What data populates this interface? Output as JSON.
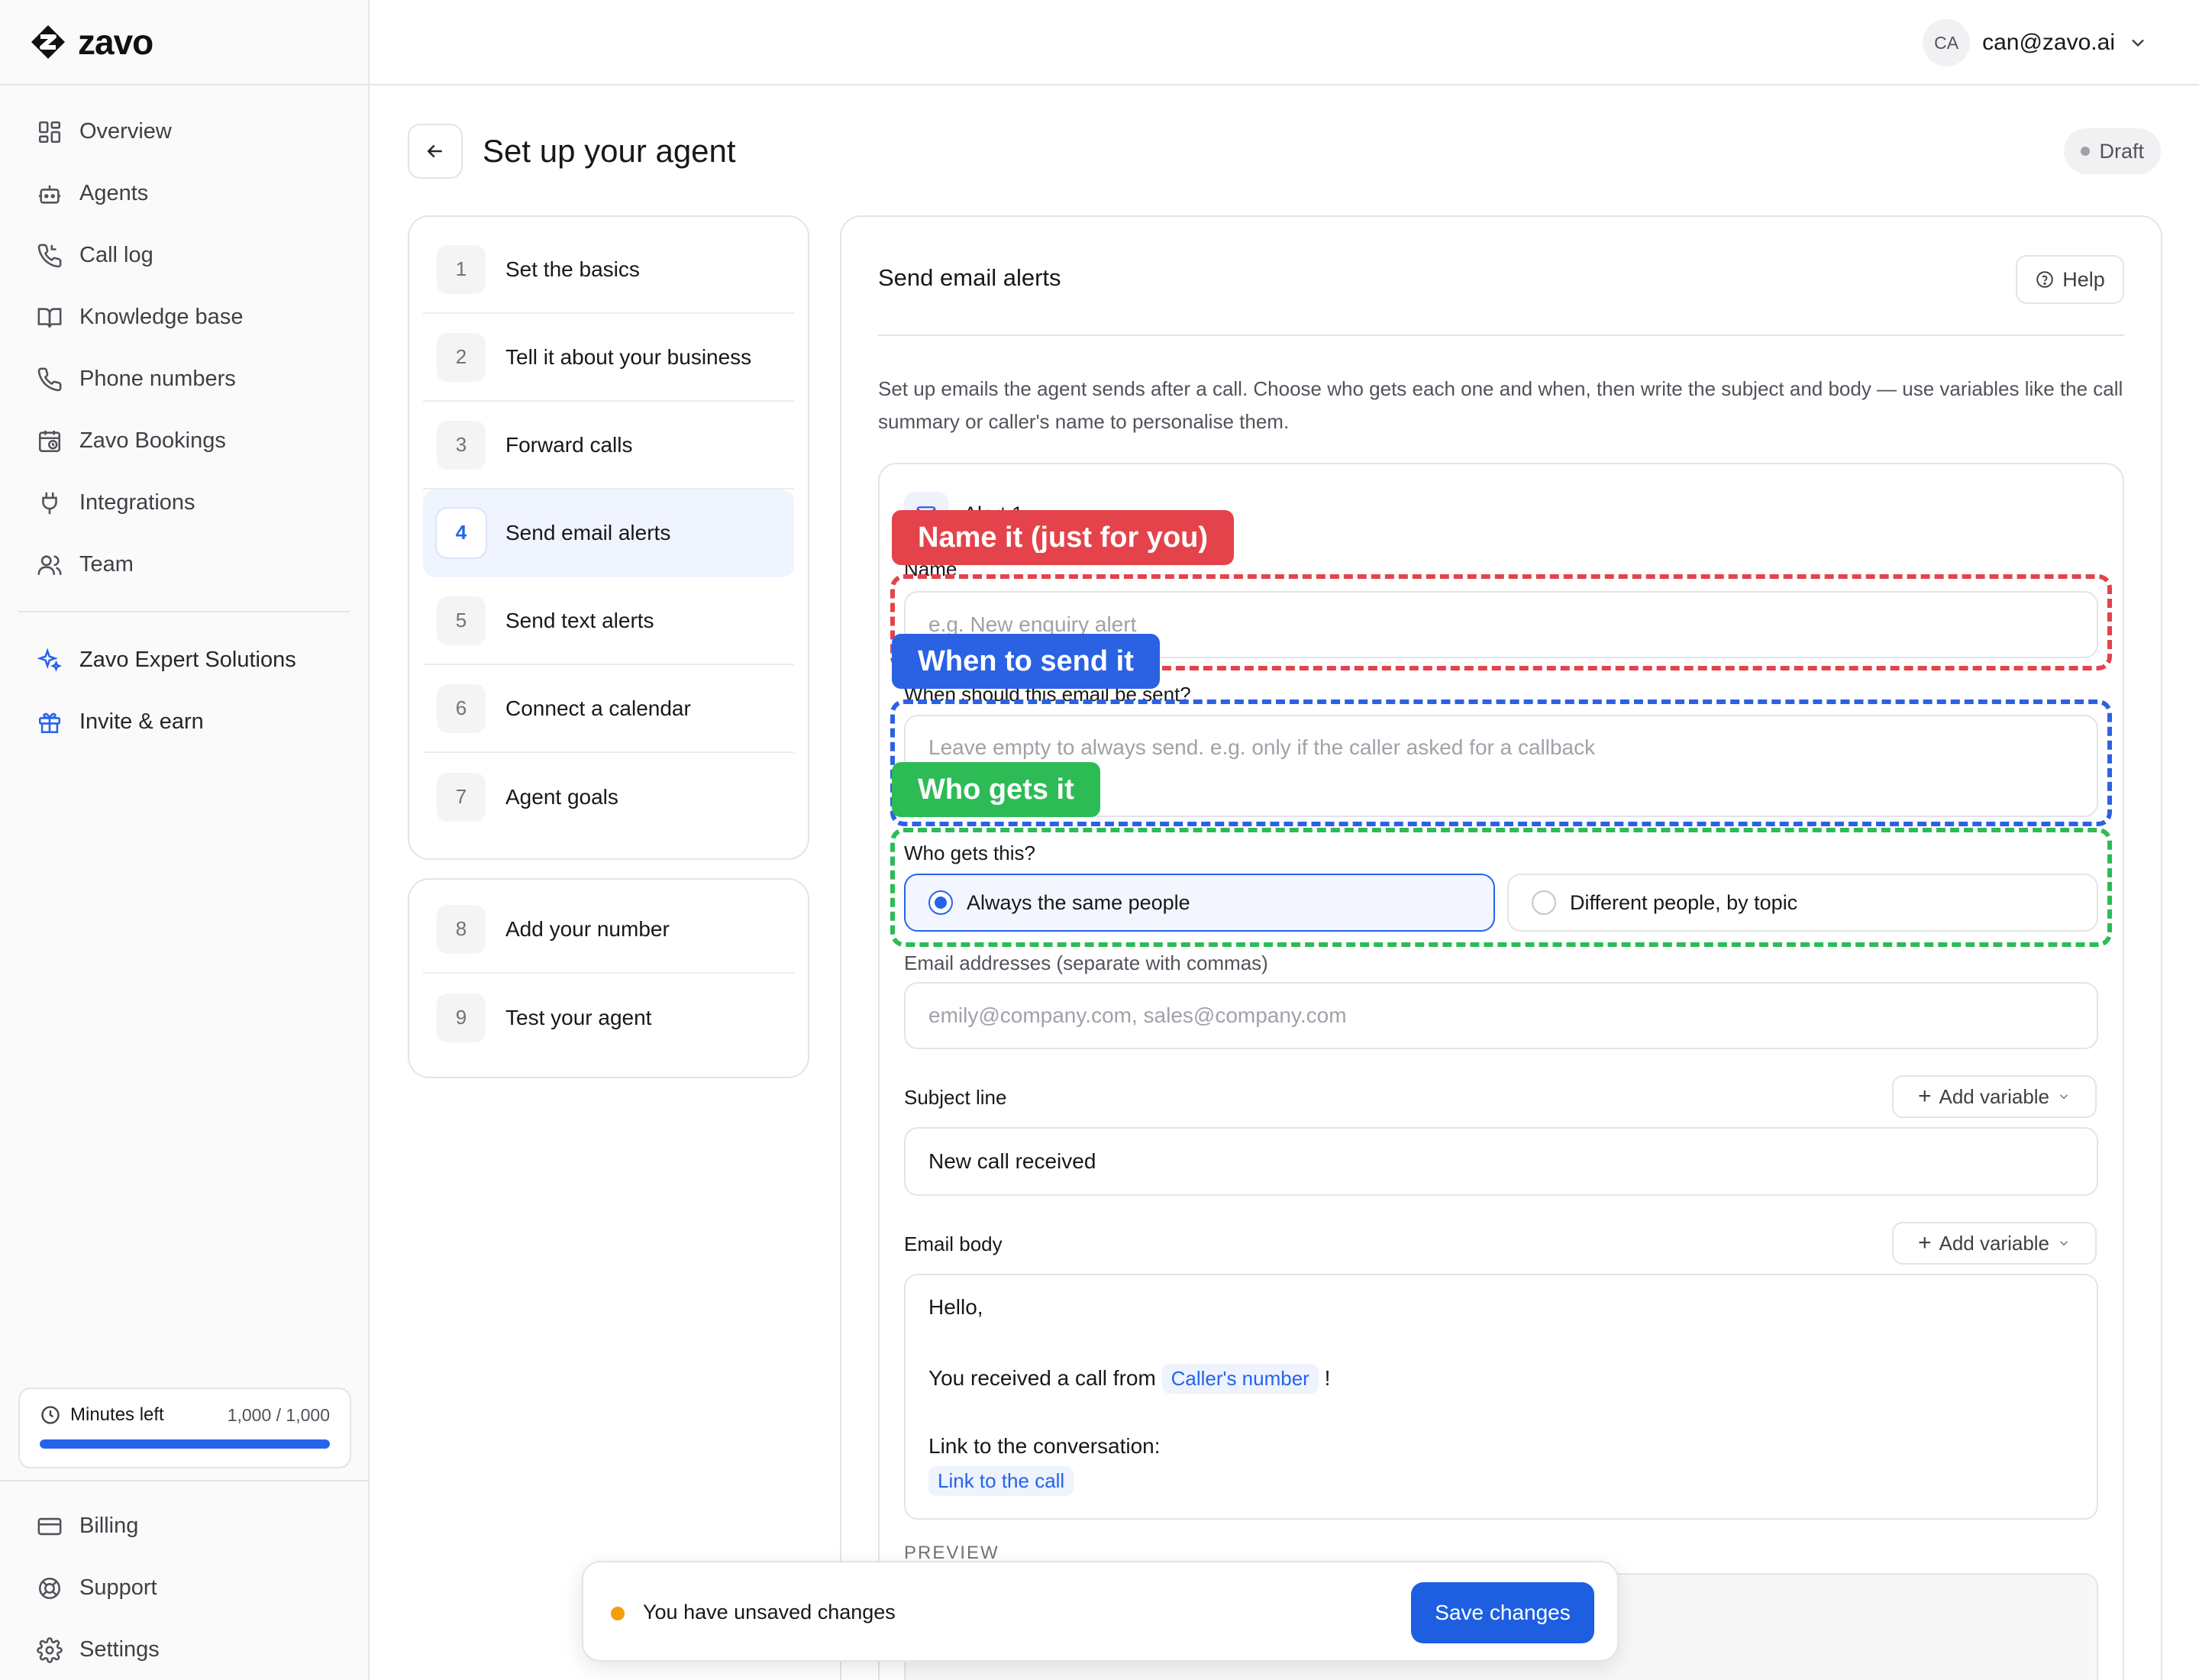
{
  "brand": {
    "name": "zavo"
  },
  "sidebar": {
    "items": [
      {
        "label": "Overview",
        "icon": "grid-icon"
      },
      {
        "label": "Agents",
        "icon": "robot-icon"
      },
      {
        "label": "Call log",
        "icon": "phone-log-icon"
      },
      {
        "label": "Knowledge base",
        "icon": "book-icon"
      },
      {
        "label": "Phone numbers",
        "icon": "phone-icon"
      },
      {
        "label": "Zavo Bookings",
        "icon": "calendar-clock-icon"
      },
      {
        "label": "Integrations",
        "icon": "plug-icon"
      },
      {
        "label": "Team",
        "icon": "users-icon"
      }
    ],
    "extras": [
      {
        "label": "Zavo Expert Solutions",
        "icon": "sparkles-icon"
      },
      {
        "label": "Invite & earn",
        "icon": "gift-icon"
      }
    ],
    "minutes": {
      "label": "Minutes left",
      "value": "1,000 / 1,000",
      "fraction": 1.0
    },
    "bottom": [
      {
        "label": "Billing",
        "icon": "card-icon"
      },
      {
        "label": "Support",
        "icon": "lifebuoy-icon"
      },
      {
        "label": "Settings",
        "icon": "gear-icon"
      }
    ]
  },
  "topbar": {
    "avatar_initials": "CA",
    "email": "can@zavo.ai"
  },
  "header": {
    "title": "Set up your agent",
    "status": "Draft"
  },
  "steps": {
    "group1": [
      {
        "num": "1",
        "label": "Set the basics"
      },
      {
        "num": "2",
        "label": "Tell it about your business"
      },
      {
        "num": "3",
        "label": "Forward calls"
      },
      {
        "num": "4",
        "label": "Send email alerts",
        "active": true
      },
      {
        "num": "5",
        "label": "Send text alerts"
      },
      {
        "num": "6",
        "label": "Connect a calendar"
      },
      {
        "num": "7",
        "label": "Agent goals"
      }
    ],
    "group2": [
      {
        "num": "8",
        "label": "Add your number"
      },
      {
        "num": "9",
        "label": "Test your agent"
      }
    ]
  },
  "section": {
    "title": "Send email alerts",
    "help_label": "Help",
    "description": "Set up emails the agent sends after a call. Choose who gets each one and when, then write the subject and body — use variables like the call summary or caller's name to personalise them."
  },
  "alert": {
    "title": "Alert 1",
    "name_label": "Name",
    "name_placeholder": "e.g. New enquiry alert",
    "when_label": "When should this email be sent?",
    "when_placeholder": "Leave empty to always send. e.g. only if the caller asked for a callback",
    "who_label": "Who gets this?",
    "who_options": [
      "Always the same people",
      "Different people, by topic"
    ],
    "who_selected": "Always the same people",
    "emails_label": "Email addresses (separate with commas)",
    "emails_placeholder": "emily@company.com, sales@company.com",
    "subject_label": "Subject line",
    "subject_value": "New call received",
    "add_variable_label": "Add variable",
    "body_label": "Email body",
    "body": {
      "line1": "Hello,",
      "line2_text": "You received a call from",
      "line2_chip": "Caller's number",
      "line2_end": "!",
      "line3": "Link to the conversation:",
      "line4_chip": "Link to the call"
    },
    "preview_label": "PREVIEW"
  },
  "annotations": {
    "red": "Name it (just for you)",
    "blue": "When to send it",
    "green": "Who gets it"
  },
  "toast": {
    "message": "You have unsaved changes",
    "save_label": "Save changes"
  },
  "colors": {
    "accent": "#2563eb",
    "red": "#e4434b",
    "blue": "#2b62e3",
    "green": "#2dbb55",
    "warning": "#f59e0b"
  }
}
